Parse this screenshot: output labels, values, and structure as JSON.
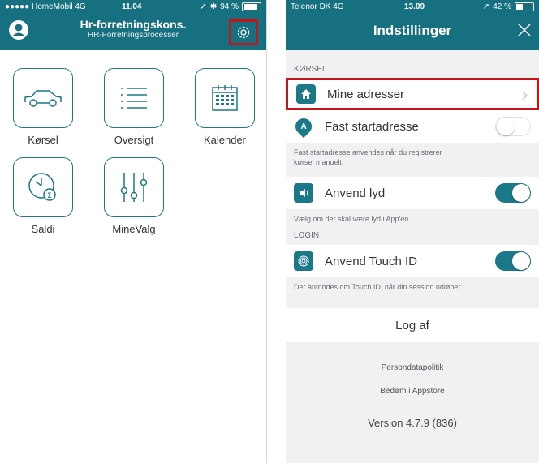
{
  "left": {
    "status": {
      "carrier": "●●●●● HomeMobil  4G",
      "time": "11.04",
      "battery": "94 %",
      "battery_level": 0.94
    },
    "header": {
      "title": "Hr-forretningskons.",
      "subtitle": "HR-Forretningsprocesser"
    },
    "tiles": [
      {
        "label": "Kørsel",
        "icon": "car-icon"
      },
      {
        "label": "Oversigt",
        "icon": "list-icon"
      },
      {
        "label": "Kalender",
        "icon": "calendar-icon"
      },
      {
        "label": "Saldi",
        "icon": "clock-balance-icon"
      },
      {
        "label": "MineValg",
        "icon": "sliders-icon"
      }
    ],
    "accent": "#17707f",
    "highlight": "#c3161c"
  },
  "right": {
    "status": {
      "carrier": "Telenor DK  4G",
      "time": "13.09",
      "battery": "42 %",
      "battery_level": 0.42
    },
    "header": {
      "title": "Indstillinger"
    },
    "sections": {
      "korsel": "KØRSEL",
      "login": "LOGIN"
    },
    "rows": {
      "mine_adresser": "Mine adresser",
      "fast_startadresse": "Fast startadresse",
      "anvend_lyd": "Anvend lyd",
      "anvend_touch_id": "Anvend Touch ID"
    },
    "toggles": {
      "fast_startadresse": false,
      "anvend_lyd": true,
      "anvend_touch_id": true
    },
    "notes": {
      "fast_start_line1": "Fast startadresse anvendes når du registrerer",
      "fast_start_line2": "kørsel manuelt.",
      "lyd": "Vælg om der skal være lyd i App'en.",
      "touch_id": "Der anmodes om Touch ID, når din session udløber."
    },
    "logout": "Log af",
    "links": {
      "privacy": "Persondatapolitik",
      "rate": "Bedøm i Appstore"
    },
    "version": "Version 4.7.9 (836)"
  }
}
